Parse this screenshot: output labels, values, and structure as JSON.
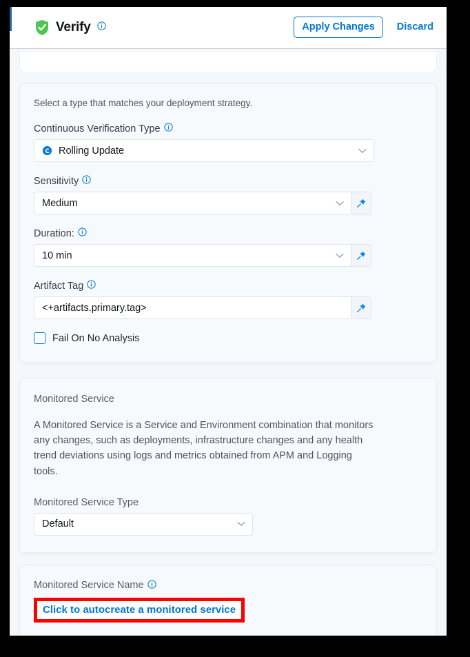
{
  "header": {
    "title": "Verify",
    "title_icon": "shield-check-icon",
    "info_icon": "info-icon",
    "apply_label": "Apply Changes",
    "discard_label": "Discard",
    "accent_color": "#1b6fa8",
    "link_color": "#0278d5",
    "shield_color": "#4dc553"
  },
  "verification": {
    "hint": "Select a type that matches your deployment strategy.",
    "cv_type": {
      "label": "Continuous Verification Type",
      "value": "Rolling Update",
      "icon": "rolling-update-icon"
    },
    "sensitivity": {
      "label": "Sensitivity",
      "value": "Medium"
    },
    "duration": {
      "label": "Duration:",
      "value": "10 min"
    },
    "artifact_tag": {
      "label": "Artifact Tag",
      "value": "<+artifacts.primary.tag>",
      "placeholder": "<+artifacts.primary.tag>"
    },
    "fail_on_no_analysis": {
      "label": "Fail On No Analysis",
      "checked": false
    }
  },
  "monitored_service": {
    "title": "Monitored Service",
    "description": "A Monitored Service is a Service and Environment combination that monitors any changes, such as deployments, infrastructure changes and any health trend deviations using logs and metrics obtained from APM and Logging tools.",
    "type_label": "Monitored Service Type",
    "type_value": "Default"
  },
  "monitored_service_name": {
    "label": "Monitored Service Name",
    "autocreate_link": "Click to autocreate a monitored service",
    "highlight_color": "#fd0000"
  }
}
